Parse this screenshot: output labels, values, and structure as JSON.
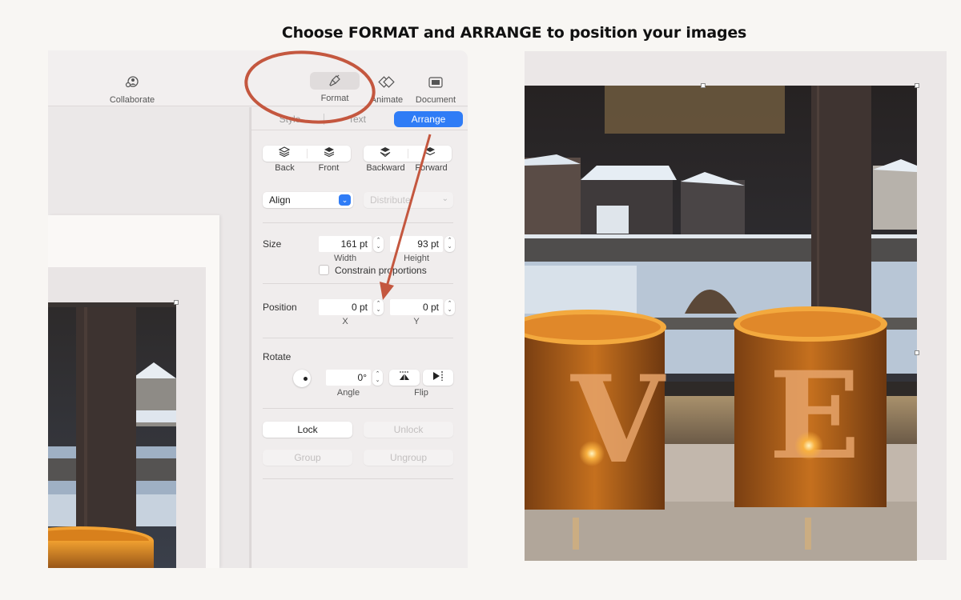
{
  "headline": "Choose FORMAT and ARRANGE to position your images",
  "colors": {
    "accent_blue": "#2f7cf6",
    "annotation_red": "#c4573f",
    "background": "#f8f6f3"
  },
  "toolbar": {
    "collaborate": {
      "label": "Collaborate",
      "icon": "collaborate-icon"
    },
    "format": {
      "label": "Format",
      "icon": "paintbrush-icon",
      "selected": true
    },
    "animate": {
      "label": "Animate",
      "icon": "animate-diamond-icon"
    },
    "document": {
      "label": "Document",
      "icon": "document-icon"
    }
  },
  "inspector": {
    "tabs": [
      {
        "label": "Style",
        "active": false
      },
      {
        "label": "Text",
        "active": false
      },
      {
        "label": "Arrange",
        "active": true
      }
    ],
    "layer_buttons": [
      {
        "label": "Back",
        "icon": "send-to-back-icon"
      },
      {
        "label": "Front",
        "icon": "bring-to-front-icon"
      },
      {
        "label": "Backward",
        "icon": "send-backward-icon"
      },
      {
        "label": "Forward",
        "icon": "bring-forward-icon"
      }
    ],
    "align": {
      "label": "Align",
      "enabled": true
    },
    "distribute": {
      "label": "Distribute",
      "enabled": false
    },
    "size": {
      "label": "Size",
      "width": {
        "value": "161 pt",
        "label": "Width"
      },
      "height": {
        "value": "93 pt",
        "label": "Height"
      },
      "constrain": {
        "label": "Constrain proportions",
        "checked": false
      }
    },
    "position": {
      "label": "Position",
      "x": {
        "value": "0 pt",
        "label": "X"
      },
      "y": {
        "value": "0 pt",
        "label": "Y"
      }
    },
    "rotate": {
      "label": "Rotate",
      "angle": {
        "value": "0°",
        "label": "Angle"
      },
      "flip_label": "Flip"
    },
    "lock": {
      "label": "Lock",
      "enabled": true
    },
    "unlock": {
      "label": "Unlock",
      "enabled": false
    },
    "group": {
      "label": "Group",
      "enabled": false
    },
    "ungroup": {
      "label": "Ungroup",
      "enabled": false
    }
  },
  "photo": {
    "description": "Two lit wooden candle lanterns with letters V and E on a windowsill, snowy houses outside",
    "letters": [
      "V",
      "E"
    ]
  }
}
